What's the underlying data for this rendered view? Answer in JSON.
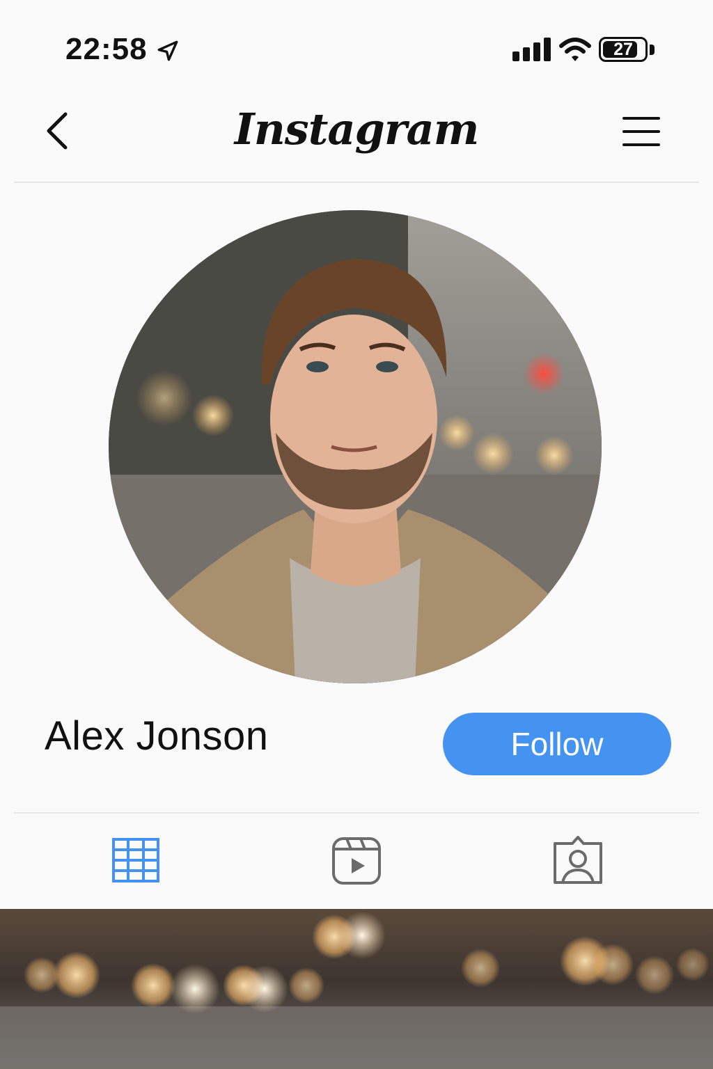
{
  "status_bar": {
    "time": "22:58",
    "battery": "27",
    "battery_percent": 27
  },
  "header": {
    "title": "Instagram"
  },
  "profile": {
    "name": "Alex Jonson",
    "follow_label": "Follow"
  },
  "tabs": [
    {
      "id": "grid",
      "icon": "grid-icon",
      "active": true
    },
    {
      "id": "reels",
      "icon": "reels-icon",
      "active": false
    },
    {
      "id": "tagged",
      "icon": "tagged-icon",
      "active": false
    }
  ],
  "colors": {
    "accent": "#4493f0",
    "inactive_icon": "#6b6b6b",
    "text": "#111111"
  }
}
